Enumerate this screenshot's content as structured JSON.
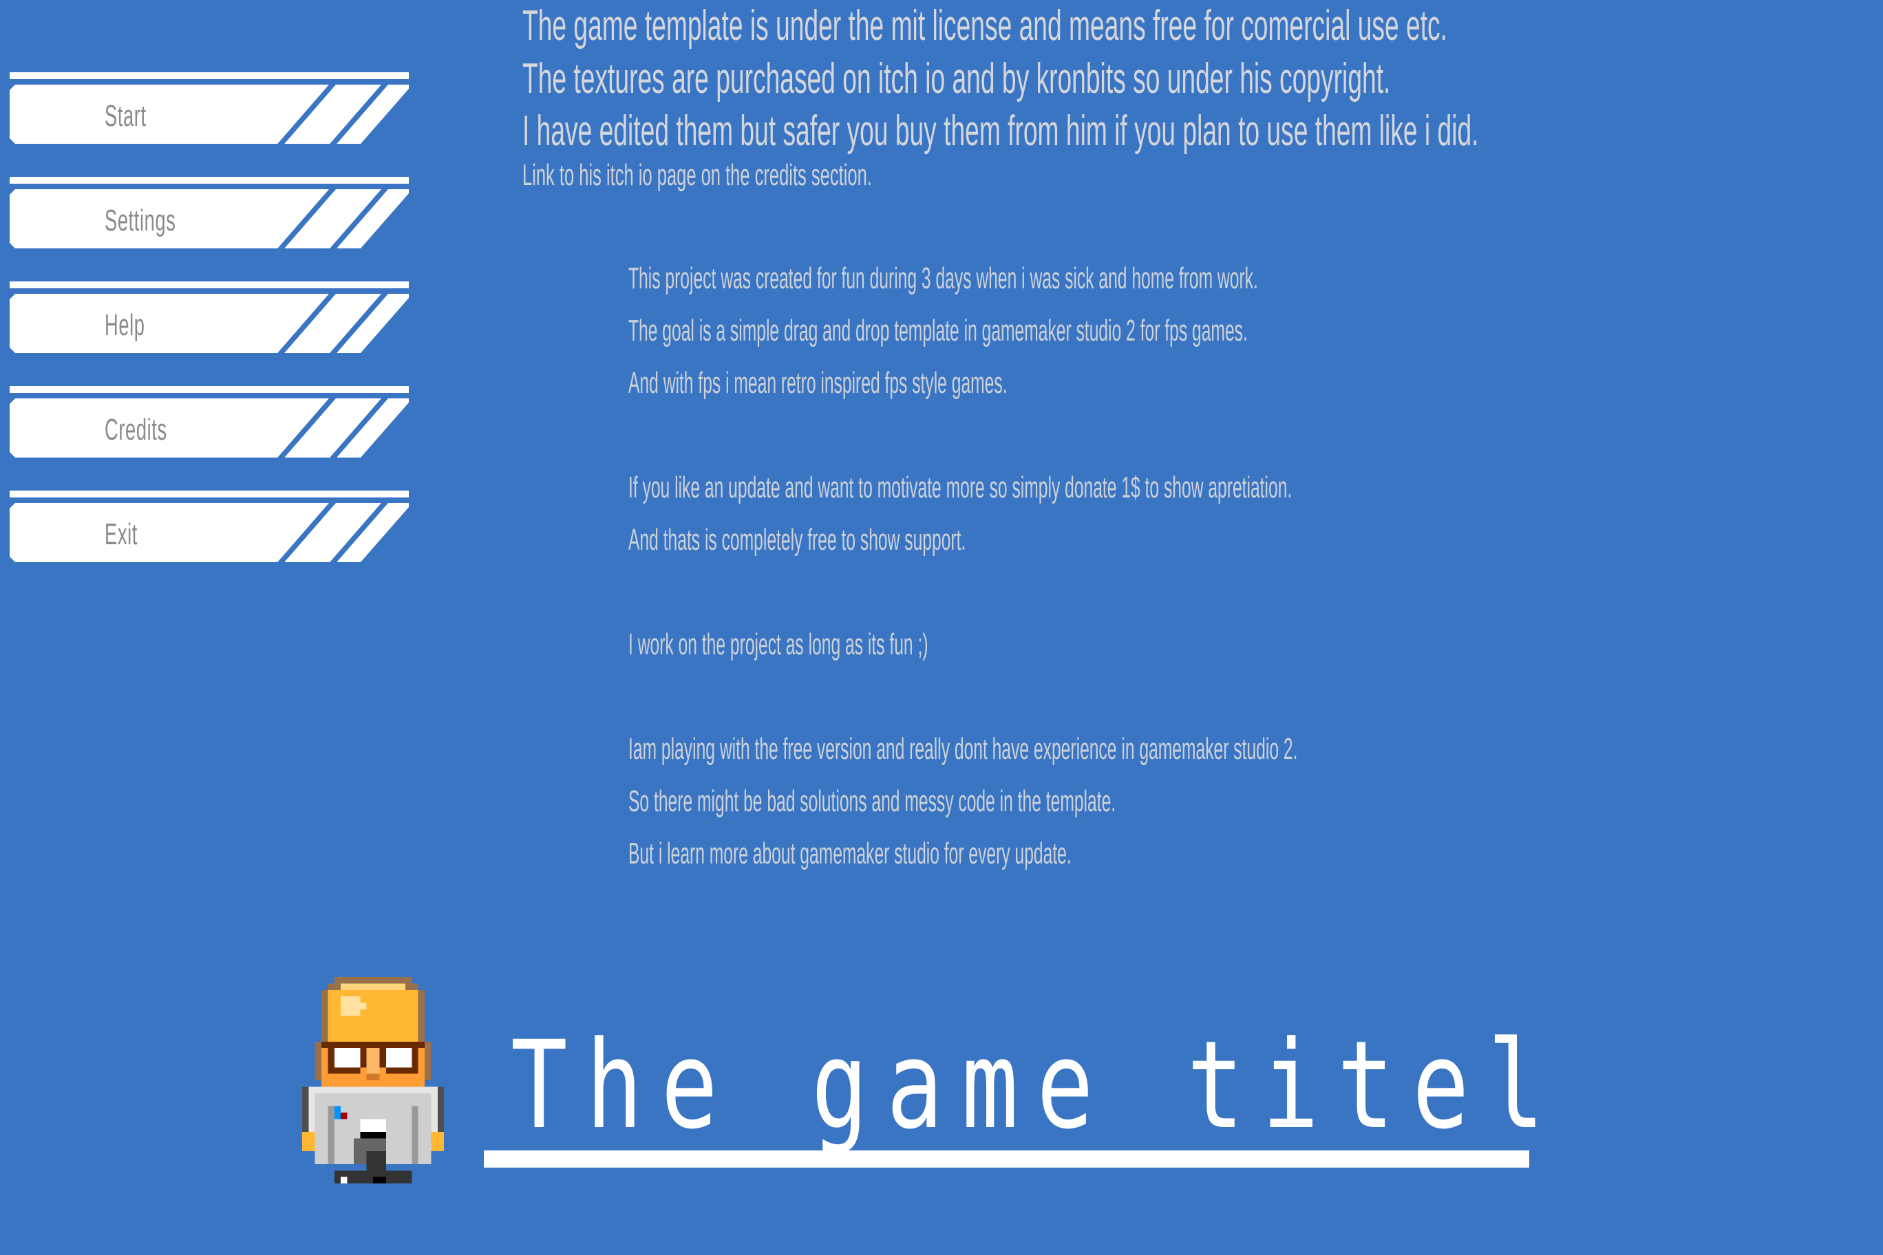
{
  "menu": {
    "buttons": [
      {
        "label": "Start"
      },
      {
        "label": "Settings"
      },
      {
        "label": "Help"
      },
      {
        "label": "Credits"
      },
      {
        "label": "Exit"
      }
    ]
  },
  "license_notice": {
    "lines": [
      "The game template is under the mit license and means free for comercial use etc.",
      "The textures are purchased on itch io and by kronbits so under his copyright.",
      "I have edited them but safer you buy them from him if you plan to use them like i did."
    ],
    "note": "Link to his itch io page on the credits section."
  },
  "about": {
    "lines": [
      "This project was created for fun during 3 days when i was sick and home from work.",
      "The goal is a simple drag and drop template in gamemaker studio 2 for fps games.",
      "And with fps i mean retro inspired fps style games.",
      "If you like an update and want to motivate more so simply donate 1$ to show apretiation.",
      "And thats is completely free to show support.",
      "I work on the project as long as its fun ;)",
      "Iam playing with the free version and really dont have experience in gamemaker studio 2.",
      "So there might be bad solutions and messy code in the template.",
      "But i learn more about gamemaker studio for every update."
    ]
  },
  "title": {
    "text": "The game titel"
  },
  "character": {
    "icon": "scientist-character-sprite"
  },
  "colors": {
    "background": "#3a75c4",
    "button": "#ffffff",
    "button_text": "#8a8a8a",
    "body_text": "#d4d6dc"
  }
}
